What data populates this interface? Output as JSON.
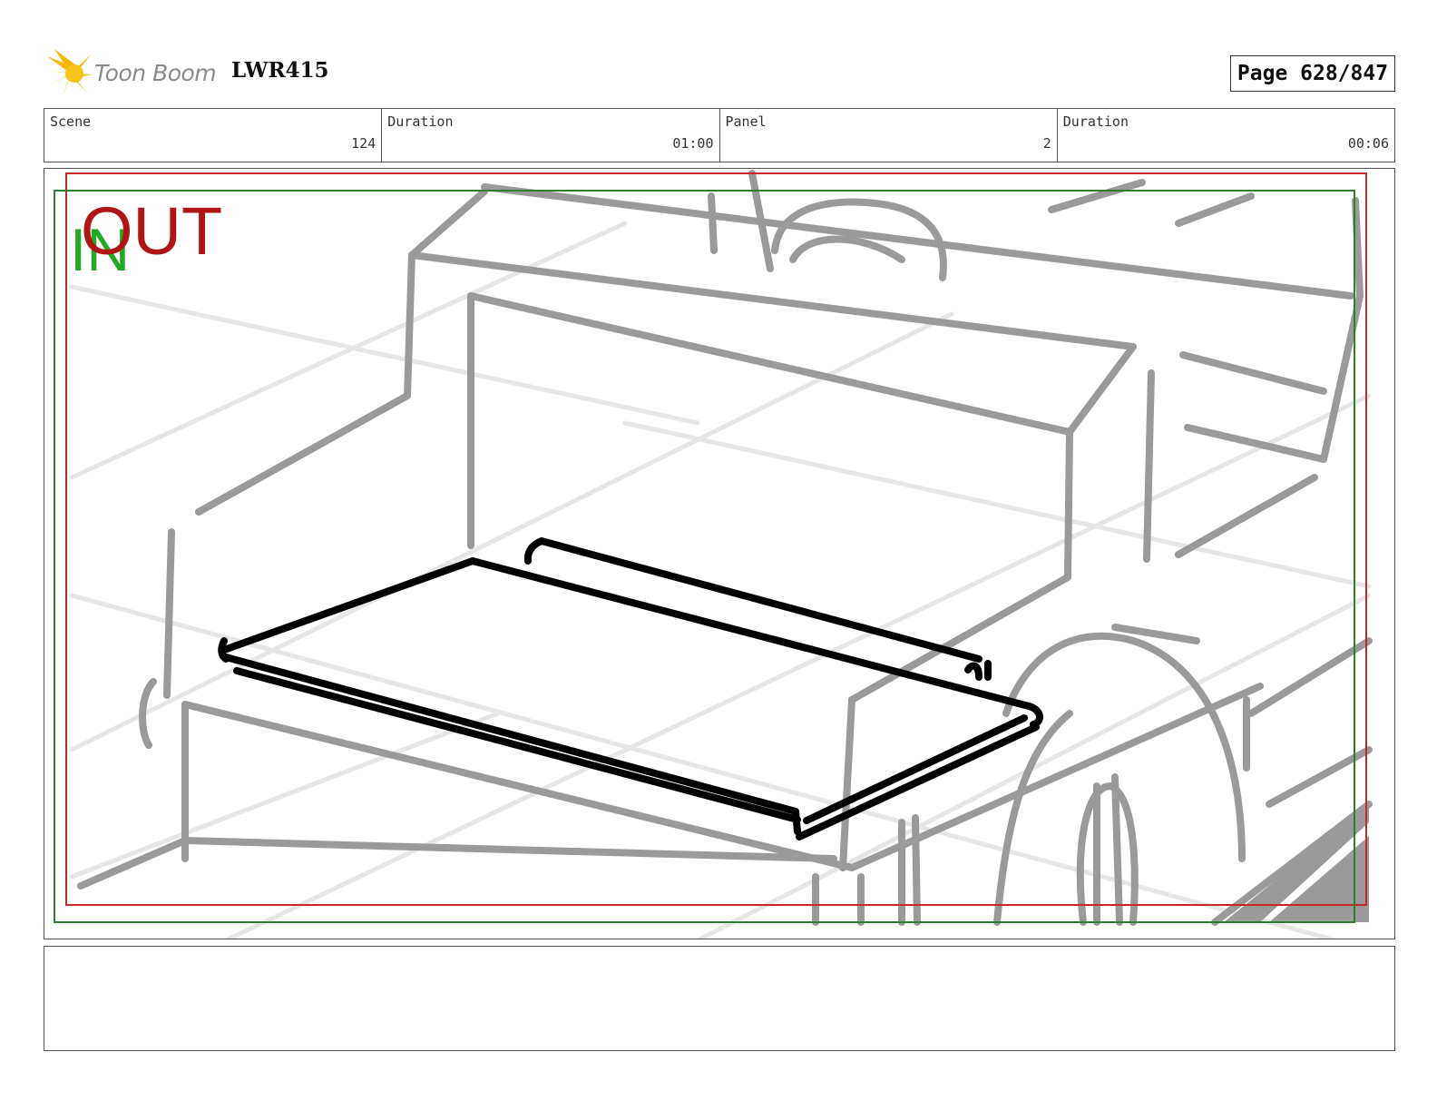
{
  "header": {
    "logo_text": "Toon Boom",
    "project_code": "LWR415",
    "page": "Page 628/847"
  },
  "info": [
    {
      "label": "Scene",
      "value": "124"
    },
    {
      "label": "Duration",
      "value": "01:00"
    },
    {
      "label": "Panel",
      "value": "2"
    },
    {
      "label": "Duration",
      "value": "00:06"
    }
  ],
  "panel": {
    "in_label": "IN",
    "out_label": "OUT"
  },
  "notes": {
    "text": ""
  },
  "colors": {
    "in_frame": "#2e7d32",
    "out_frame": "#c62828",
    "in_text": "#22a822",
    "out_text": "#b01414",
    "sketch_gray": "#9a9a9a",
    "sketch_light": "#e8e8e8",
    "ink": "#000000"
  }
}
